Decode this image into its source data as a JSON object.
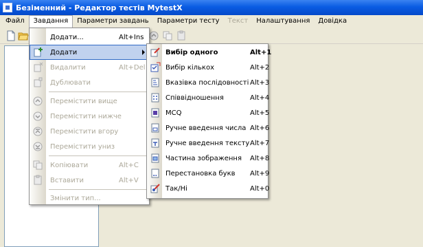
{
  "window": {
    "title": "Безіменний - Редактор тестів MytestX"
  },
  "menubar": {
    "items": [
      {
        "label": "Файл",
        "state": "normal"
      },
      {
        "label": "Завдання",
        "state": "open"
      },
      {
        "label": "Параметри завдань",
        "state": "normal"
      },
      {
        "label": "Параметри тесту",
        "state": "normal"
      },
      {
        "label": "Текст",
        "state": "disabled"
      },
      {
        "label": "Налаштування",
        "state": "normal"
      },
      {
        "label": "Довідка",
        "state": "normal"
      }
    ]
  },
  "tasks_menu": {
    "header": {
      "label": "Додати...",
      "shortcut": "Alt+Ins"
    },
    "items": [
      {
        "label": "Додати",
        "shortcut": "",
        "icon": "add-icon",
        "state": "selected",
        "has_submenu": true
      },
      {
        "label": "Видалити",
        "shortcut": "Alt+Del",
        "icon": "delete-icon",
        "state": "disabled"
      },
      {
        "label": "Дублювати",
        "shortcut": "",
        "icon": "duplicate-icon",
        "state": "disabled"
      },
      {
        "label": "Перемістити вище",
        "shortcut": "",
        "icon": "move-up-icon",
        "state": "disabled"
      },
      {
        "label": "Перемістити нижче",
        "shortcut": "",
        "icon": "move-down-icon",
        "state": "disabled"
      },
      {
        "label": "Перемістити вгору",
        "shortcut": "",
        "icon": "move-top-icon",
        "state": "disabled"
      },
      {
        "label": "Перемістити униз",
        "shortcut": "",
        "icon": "move-bottom-icon",
        "state": "disabled"
      },
      {
        "label": "Копіювати",
        "shortcut": "Alt+C",
        "icon": "copy-icon",
        "state": "disabled"
      },
      {
        "label": "Вставити",
        "shortcut": "Alt+V",
        "icon": "paste-icon",
        "state": "disabled"
      },
      {
        "label": "Змінити тип...",
        "shortcut": "",
        "icon": "",
        "state": "disabled"
      }
    ]
  },
  "add_submenu": {
    "items": [
      {
        "label": "Вибір одного",
        "shortcut": "Alt+1",
        "icon": "single-choice-icon",
        "bold": true
      },
      {
        "label": "Вибір кількох",
        "shortcut": "Alt+2",
        "icon": "multiple-choice-icon"
      },
      {
        "label": "Вказівка послідовності",
        "shortcut": "Alt+3",
        "icon": "sequence-icon"
      },
      {
        "label": "Співвідношення",
        "shortcut": "Alt+4",
        "icon": "matching-icon"
      },
      {
        "label": "MCQ",
        "shortcut": "Alt+5",
        "icon": "mcq-icon"
      },
      {
        "label": "Ручне введення числа",
        "shortcut": "Alt+6",
        "icon": "number-input-icon"
      },
      {
        "label": "Ручне введення тексту",
        "shortcut": "Alt+7",
        "icon": "text-input-icon"
      },
      {
        "label": "Частина зображення",
        "shortcut": "Alt+8",
        "icon": "image-area-icon"
      },
      {
        "label": "Перестановка букв",
        "shortcut": "Alt+9",
        "icon": "letters-icon"
      },
      {
        "label": "Так/Ні",
        "shortcut": "Alt+0",
        "icon": "yes-no-icon"
      }
    ]
  },
  "colors": {
    "titlebar": "#0a5ce3",
    "menu_highlight": "#c1d2ee",
    "menu_highlight_border": "#316ac5",
    "disabled_text": "#aca899"
  }
}
